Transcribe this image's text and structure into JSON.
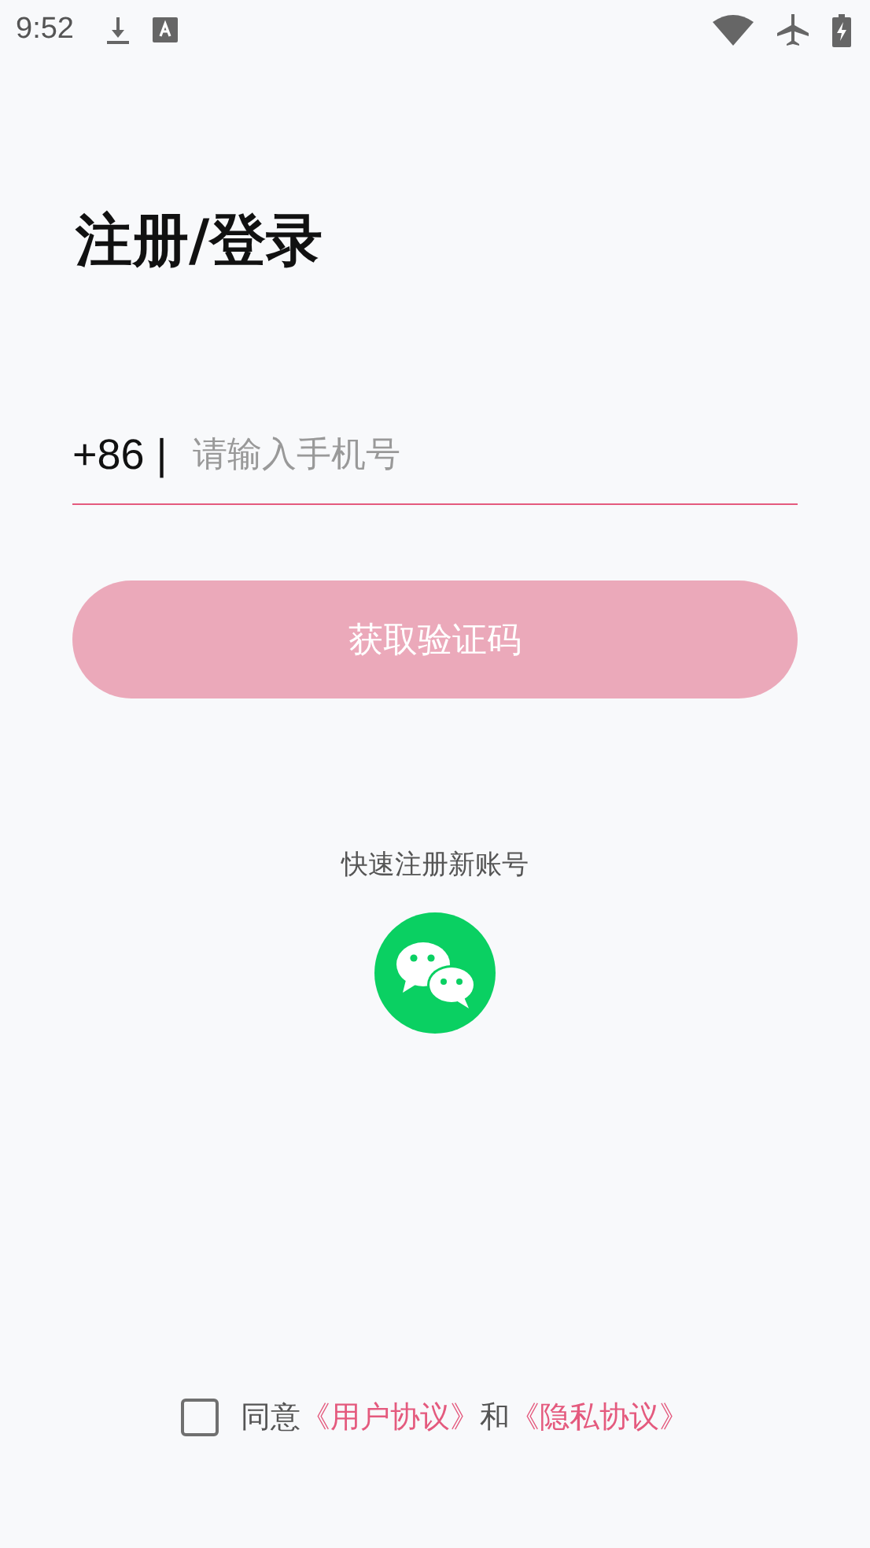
{
  "status_bar": {
    "time": "9:52"
  },
  "title": "注册/登录",
  "phone": {
    "prefix": "+86 |",
    "placeholder": "请输入手机号"
  },
  "code_button": {
    "label": "获取验证码",
    "disabled": true
  },
  "quick_register": {
    "label": "快速注册新账号"
  },
  "agreement": {
    "checked": false,
    "parts": [
      {
        "kind": "text",
        "text": "同意"
      },
      {
        "kind": "link",
        "text": "《用户协议》"
      },
      {
        "kind": "text",
        "text": "和"
      },
      {
        "kind": "link",
        "text": "《隐私协议》"
      }
    ]
  }
}
